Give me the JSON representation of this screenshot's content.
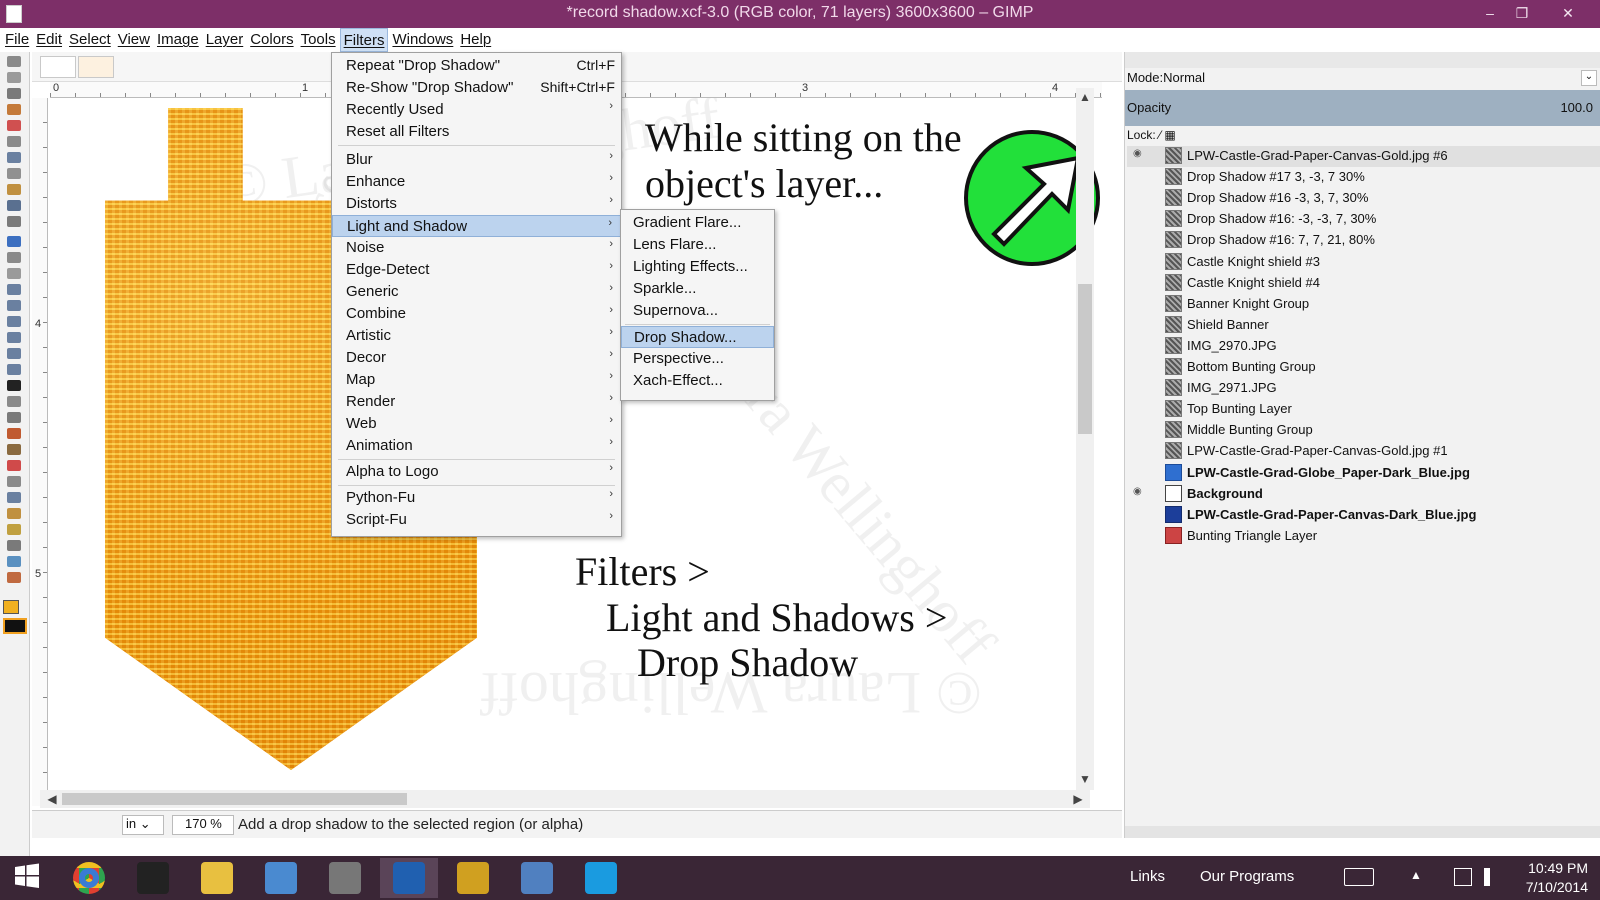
{
  "window": {
    "title": "*record shadow.xcf-3.0 (RGB color, 71 layers) 3600x3600 – GIMP",
    "minimize": "–",
    "maximize": "❐",
    "close": "✕"
  },
  "menubar": [
    "File",
    "Edit",
    "Select",
    "View",
    "Image",
    "Layer",
    "Colors",
    "Tools",
    "Filters",
    "Windows",
    "Help"
  ],
  "filters_menu": {
    "top_items": [
      {
        "label": "Repeat \"Drop Shadow\"",
        "shortcut": "Ctrl+F"
      },
      {
        "label": "Re-Show \"Drop Shadow\"",
        "shortcut": "Shift+Ctrl+F"
      },
      {
        "label": "Recently Used",
        "shortcut": "›"
      },
      {
        "label": "Reset all Filters",
        "shortcut": ""
      }
    ],
    "items": [
      "Blur",
      "Enhance",
      "Distorts",
      "Light and Shadow",
      "Noise",
      "Edge-Detect",
      "Generic",
      "Combine",
      "Artistic",
      "Decor",
      "Map",
      "Render",
      "Web",
      "Animation"
    ],
    "extra_items": [
      "Alpha to Logo"
    ],
    "script_items": [
      "Python-Fu",
      "Script-Fu"
    ],
    "highlighted": "Light and Shadow",
    "arrow": "›"
  },
  "light_shadow_submenu": {
    "items": [
      "Gradient Flare...",
      "Lens Flare...",
      "Lighting Effects...",
      "Sparkle...",
      "Supernova..."
    ],
    "items2": [
      "Drop Shadow...",
      "Perspective...",
      "Xach-Effect..."
    ],
    "highlighted": "Drop Shadow..."
  },
  "ruler": {
    "h_ticks": [
      "0",
      "1",
      "3",
      "4"
    ],
    "v_ticks": [
      "4",
      "5"
    ]
  },
  "canvas": {
    "annotation_top_line1": "While sitting on the",
    "annotation_top_line2": "object's layer...",
    "annotation_bottom_line1": "Filters >",
    "annotation_bottom_line2": "Light and Shadows >",
    "annotation_bottom_line3": "Drop Shadow",
    "watermark": "© Laura Wellinghoff",
    "banner_color": "#f3a01a",
    "arrow_color": "#22e03a"
  },
  "statusbar": {
    "unit": "in",
    "zoom": "170 %",
    "message": "Add a drop shadow to the selected region (or alpha)"
  },
  "layers": {
    "mode_label": "Mode:",
    "mode_value": "Normal",
    "opacity_label": "Opacity",
    "opacity_value": "100.0",
    "lock_label": "Lock:",
    "list": [
      {
        "name": "LPW-Castle-Grad-Paper-Canvas-Gold.jpg #6",
        "thumb": "pattern",
        "bold": false,
        "eye": true
      },
      {
        "name": "Drop Shadow #17 3, -3, 7 30%",
        "thumb": "pattern",
        "bold": false,
        "eye": false
      },
      {
        "name": "Drop Shadow #16 -3, 3, 7, 30%",
        "thumb": "pattern",
        "bold": false,
        "eye": false
      },
      {
        "name": "Drop Shadow #16: -3, -3, 7, 30%",
        "thumb": "pattern",
        "bold": false,
        "eye": false
      },
      {
        "name": "Drop Shadow #16: 7, 7, 21, 80%",
        "thumb": "pattern",
        "bold": false,
        "eye": false
      },
      {
        "name": "Castle Knight shield #3",
        "thumb": "pattern",
        "bold": false,
        "eye": false
      },
      {
        "name": "Castle Knight shield #4",
        "thumb": "pattern",
        "bold": false,
        "eye": false
      },
      {
        "name": "Banner Knight Group",
        "thumb": "pattern",
        "bold": false,
        "eye": false
      },
      {
        "name": "Shield Banner",
        "thumb": "pattern",
        "bold": false,
        "eye": false
      },
      {
        "name": "IMG_2970.JPG",
        "thumb": "pattern",
        "bold": false,
        "eye": false
      },
      {
        "name": "Bottom Bunting Group",
        "thumb": "pattern",
        "bold": false,
        "eye": false
      },
      {
        "name": "IMG_2971.JPG",
        "thumb": "pattern",
        "bold": false,
        "eye": false
      },
      {
        "name": "Top Bunting Layer",
        "thumb": "pattern",
        "bold": false,
        "eye": false
      },
      {
        "name": "Middle Bunting Group",
        "thumb": "pattern",
        "bold": false,
        "eye": false
      },
      {
        "name": "LPW-Castle-Grad-Paper-Canvas-Gold.jpg #1",
        "thumb": "pattern",
        "bold": false,
        "eye": false
      },
      {
        "name": "LPW-Castle-Grad-Globe_Paper-Dark_Blue.jpg",
        "thumb": "blue",
        "bold": true,
        "eye": false
      },
      {
        "name": "Background",
        "thumb": "white",
        "bold": true,
        "eye": true
      },
      {
        "name": "LPW-Castle-Grad-Paper-Canvas-Dark_Blue.jpg",
        "thumb": "navy",
        "bold": true,
        "eye": false
      },
      {
        "name": "Bunting Triangle Layer",
        "thumb": "red",
        "bold": false,
        "eye": false
      }
    ]
  },
  "taskbar": {
    "links": "Links",
    "programs": "Our Programs",
    "time": "10:49 PM",
    "date": "7/10/2014",
    "apps": [
      "windows-start-icon",
      "chrome-icon",
      "inkscape-icon",
      "file-explorer-icon",
      "notepad-icon",
      "gimp-icon",
      "lenovo-icon",
      "picasa-icon",
      "search-tool-icon",
      "skype-icon"
    ]
  }
}
